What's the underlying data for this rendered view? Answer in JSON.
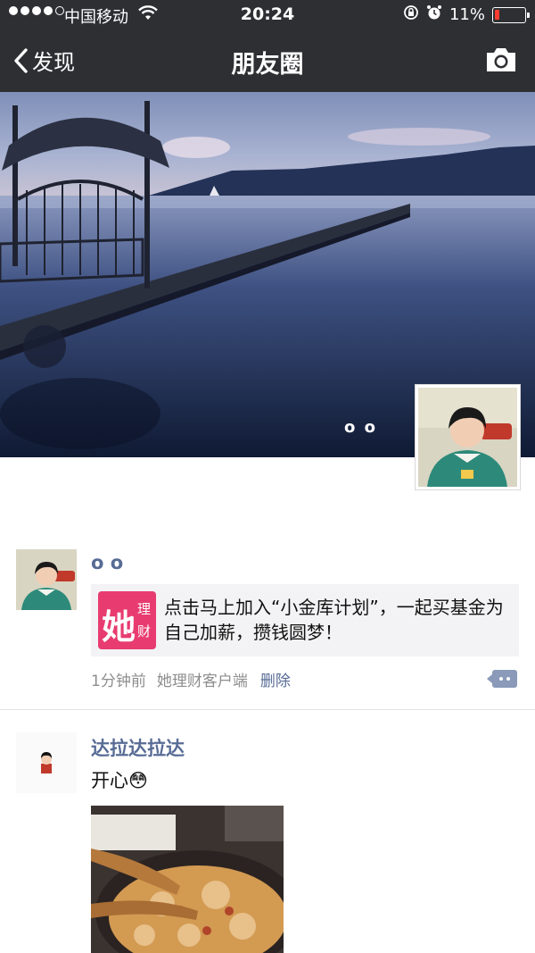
{
  "status_bar": {
    "carrier": "中国移动",
    "time": "20:24",
    "battery": "11%"
  },
  "nav": {
    "back_label": "发现",
    "title": "朋友圈"
  },
  "cover": {
    "user_name": "o o"
  },
  "posts": [
    {
      "name": "o o",
      "share": {
        "logo_main": "她",
        "logo_sub1": "理",
        "logo_sub2": "财",
        "text": "点击马上加入“小金库计划”，一起买基金为自己加薪，攒钱圆梦！"
      },
      "time": "1分钟前",
      "source": "她理财客户端",
      "delete_label": "删除"
    },
    {
      "name": "达拉达拉达",
      "text": "开心😳"
    }
  ],
  "colors": {
    "nav_bg": "#2e2f33",
    "link": "#576b95",
    "brand_pink": "#e83c70"
  }
}
